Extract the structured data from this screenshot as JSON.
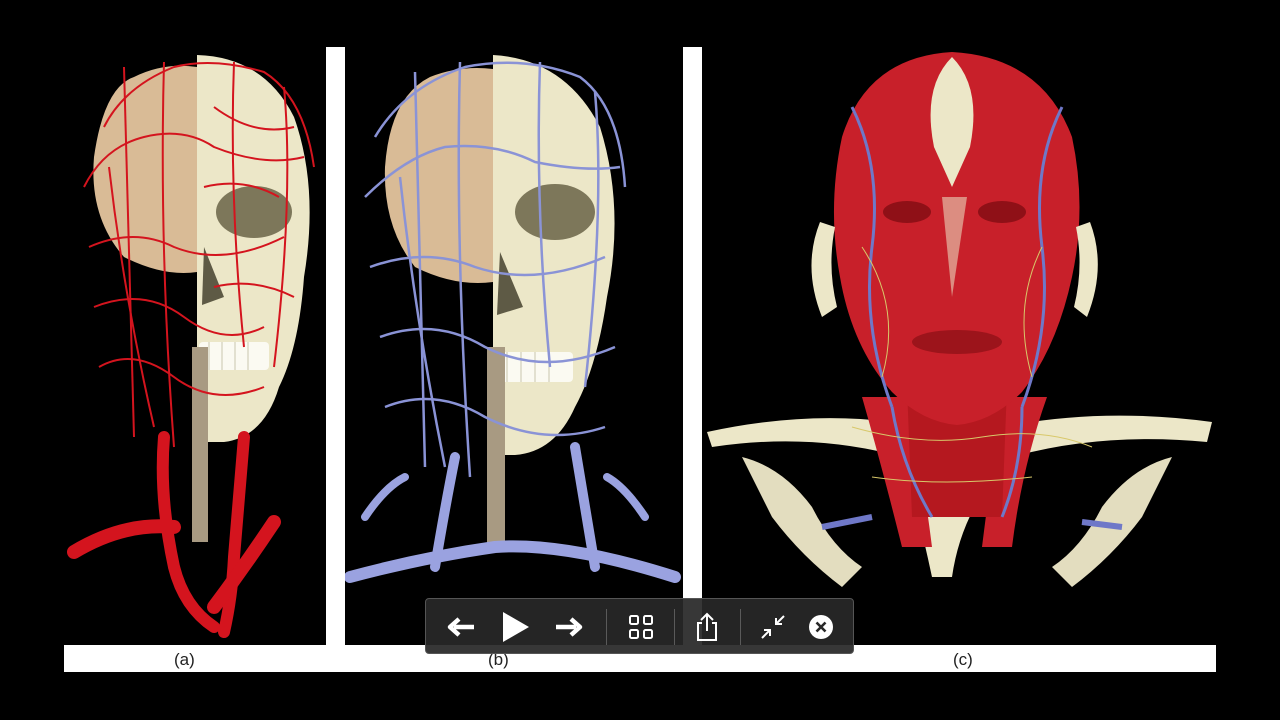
{
  "figure": {
    "captions": [
      {
        "id": "a",
        "label": "(a)"
      },
      {
        "id": "b",
        "label": "(b)"
      },
      {
        "id": "c",
        "label": "(c)"
      }
    ]
  },
  "toolbar": {
    "buttons": [
      {
        "name": "previous-button",
        "icon": "arrow-left-icon"
      },
      {
        "name": "play-button",
        "icon": "play-icon"
      },
      {
        "name": "next-button",
        "icon": "arrow-right-icon"
      },
      {
        "name": "index-sheet-button",
        "icon": "grid-icon"
      },
      {
        "name": "share-button",
        "icon": "share-icon"
      },
      {
        "name": "exit-fullscreen-button",
        "icon": "collapse-icon"
      },
      {
        "name": "close-button",
        "icon": "close-icon"
      }
    ]
  },
  "colors": {
    "background": "#000000",
    "arteries": "#d4141e",
    "veins": "#8a93d6",
    "bone": "#ece7c8",
    "brain": "#d9bb96",
    "muscle": "#c8202a",
    "toolbar_bg": "#282828",
    "icon": "#ffffff"
  }
}
